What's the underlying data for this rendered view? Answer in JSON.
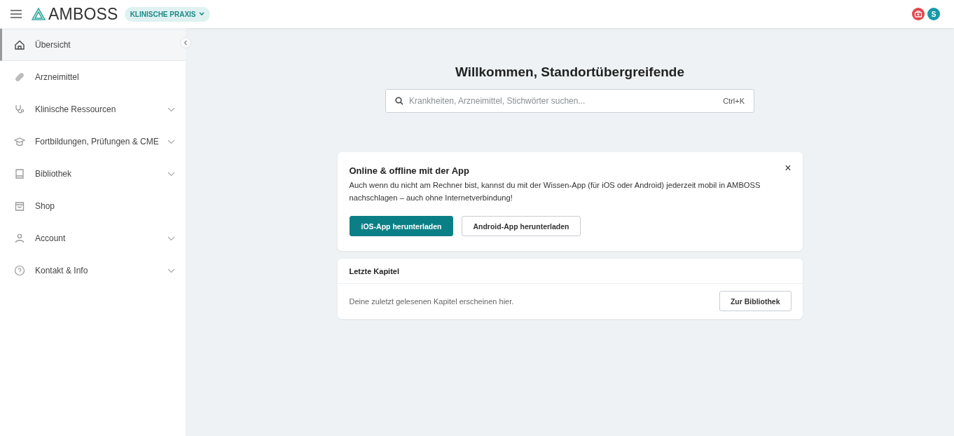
{
  "header": {
    "logo": "AMBOSS",
    "mode": "KLINISCHE PRAXIS",
    "avatar": "S"
  },
  "sidebar": {
    "items": [
      {
        "label": "Übersicht",
        "selected": true,
        "expandable": false
      },
      {
        "label": "Arzneimittel",
        "selected": false,
        "expandable": false
      },
      {
        "label": "Klinische Ressourcen",
        "selected": false,
        "expandable": true
      },
      {
        "label": "Fortbildungen, Prüfungen & CME",
        "selected": false,
        "expandable": true
      },
      {
        "label": "Bibliothek",
        "selected": false,
        "expandable": true
      },
      {
        "label": "Shop",
        "selected": false,
        "expandable": false
      },
      {
        "label": "Account",
        "selected": false,
        "expandable": true
      },
      {
        "label": "Kontakt & Info",
        "selected": false,
        "expandable": true
      }
    ]
  },
  "main": {
    "title": "Willkommen, Standortübergreifende",
    "search": {
      "placeholder": "Krankheiten, Arzneimittel, Stichwörter suchen...",
      "shortcut": "Ctrl+K"
    },
    "app_card": {
      "title": "Online & offline mit der App",
      "text": "Auch wenn du nicht am Rechner bist, kannst du mit der Wissen-App (für iOS oder Android) jederzeit mobil in AMBOSS nachschlagen – auch ohne Internetverbindung!",
      "close": "×",
      "buttons": [
        {
          "label": "iOS-App herunterladen",
          "primary": true
        },
        {
          "label": "Android-App herunterladen",
          "primary": false
        }
      ]
    },
    "recent_card": {
      "title": "Letzte Kapitel",
      "text": "Deine zuletzt gelesenen Kapitel erscheinen hier.",
      "button": "Zur Bibliothek"
    }
  }
}
